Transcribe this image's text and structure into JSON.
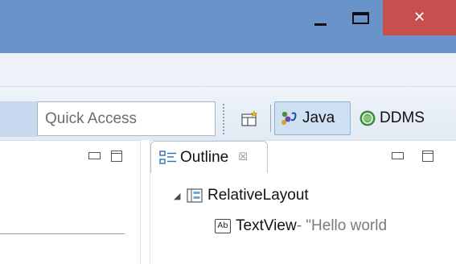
{
  "window": {
    "minimize_glyph": "",
    "close_glyph": "✕",
    "close_color": "#c7504f",
    "titlebar_color": "#6a94c9"
  },
  "toolbar": {
    "quick_access": {
      "value": "Quick Access",
      "placeholder": "Quick Access"
    },
    "perspectives": [
      {
        "label": "Java",
        "icon": "java-perspective-icon",
        "active": true
      },
      {
        "label": "DDMS",
        "icon": "ddms-perspective-icon",
        "active": false
      }
    ],
    "open_perspective_icon": "open-perspective-icon"
  },
  "outline": {
    "tab_label": "Outline",
    "tab_close_glyph": "☒",
    "tree": [
      {
        "label": "RelativeLayout",
        "expanded": true,
        "icon": "relative-layout-icon",
        "detail": ""
      },
      {
        "label": "TextView",
        "icon": "textview-icon",
        "icon_text": "Ab",
        "detail": " - \"Hello world"
      }
    ]
  }
}
